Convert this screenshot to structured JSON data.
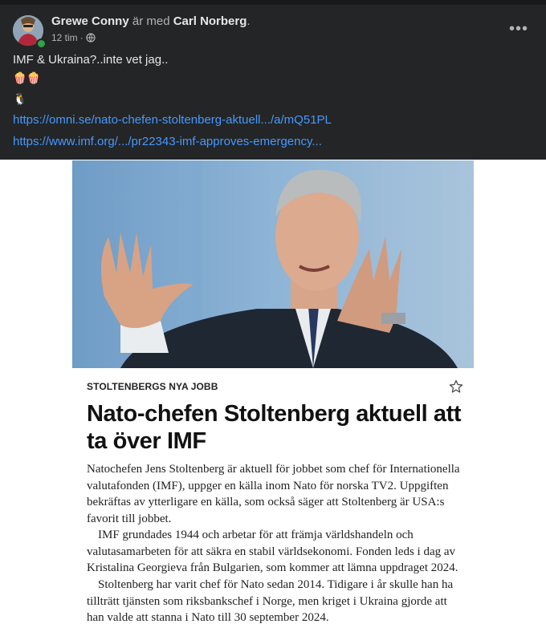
{
  "post": {
    "author": "Grewe Conny",
    "with_text": "är med",
    "tagged": "Carl Norberg",
    "period": ".",
    "time": "12 tim",
    "dot": "·",
    "text": "IMF & Ukraina?..inte vet jag..",
    "emoji_line_1": "🍿🍿",
    "emoji_line_2": "🐧",
    "links": [
      "https://omni.se/nato-chefen-stoltenberg-aktuell.../a/mQ51PL",
      "https://www.imf.org/.../pr22343-imf-approves-emergency..."
    ],
    "more_label": "•••"
  },
  "article": {
    "kicker": "STOLTENBERGS NYA JOBB",
    "headline": "Nato-chefen Stoltenberg aktuell att ta över IMF",
    "paragraphs": [
      "Natochefen Jens Stoltenberg är aktuell för jobbet som chef för Internationella valutafonden (IMF), uppger en källa inom Nato för norska TV2. Uppgiften bekräftas av ytterligare en källa, som också säger att Stoltenberg är USA:s favorit till jobbet.",
      "IMF grundades 1944 och arbetar för att främja världshandeln och valutasamarbeten för att säkra en stabil världsekonomi. Fonden leds i dag av Kristalina Georgieva från Bulgarien, som kommer att lämna uppdraget 2024.",
      "Stoltenberg har varit chef för Nato sedan 2014. Tidigare i år skulle han ha tillträtt tjänsten som riksbankschef i Norge, men kriget i Ukraina gjorde att han valde att stanna i Nato till 30 september 2024."
    ]
  },
  "colors": {
    "post_bg": "#242526",
    "link": "#4599ff",
    "text": "#e4e6eb",
    "secondary_text": "#b0b3b8"
  }
}
